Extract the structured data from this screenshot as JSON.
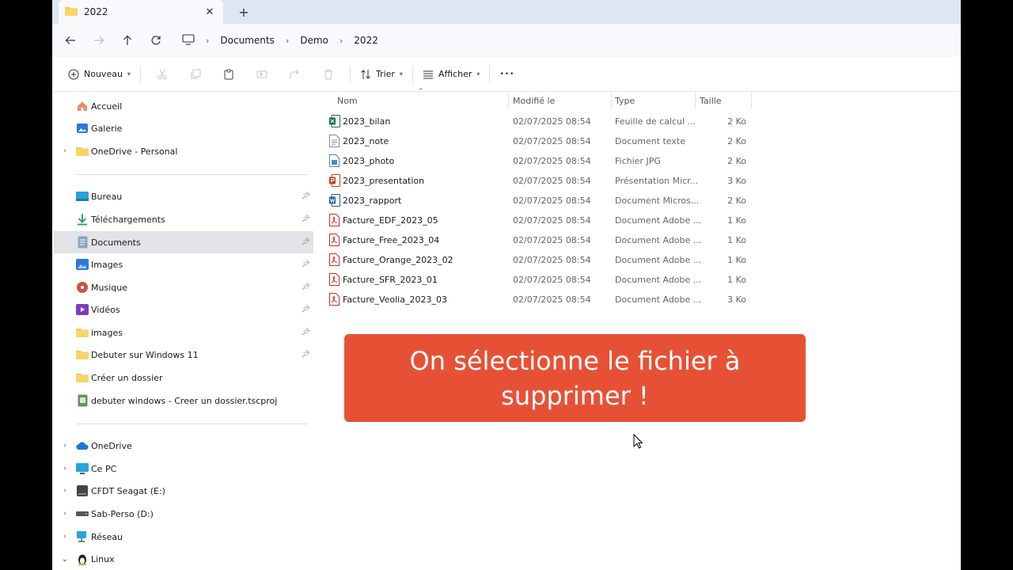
{
  "tab": {
    "title": "2022",
    "close": "✕",
    "new_tab": "+"
  },
  "address": {
    "crumbs": [
      "Documents",
      "Demo",
      "2022"
    ],
    "separator": "›"
  },
  "toolbar": {
    "new_label": "Nouveau",
    "sort_label": "Trier",
    "view_label": "Afficher",
    "more": "•••"
  },
  "sidebar": {
    "quick": [
      {
        "label": "Accueil",
        "icon": "home-icon"
      },
      {
        "label": "Galerie",
        "icon": "gallery-icon"
      },
      {
        "label": "OneDrive - Personal",
        "icon": "folder-icon",
        "expandable": true
      }
    ],
    "pinned": [
      {
        "label": "Bureau",
        "icon": "desktop-icon",
        "pinned": true
      },
      {
        "label": "Téléchargements",
        "icon": "download-icon",
        "pinned": true
      },
      {
        "label": "Documents",
        "icon": "documents-icon",
        "pinned": true,
        "selected": true
      },
      {
        "label": "Images",
        "icon": "images-icon",
        "pinned": true
      },
      {
        "label": "Musique",
        "icon": "music-icon",
        "pinned": true
      },
      {
        "label": "Vidéos",
        "icon": "video-icon",
        "pinned": true
      },
      {
        "label": "images",
        "icon": "folder-icon",
        "pinned": true
      },
      {
        "label": "Debuter sur Windows 11",
        "icon": "folder-icon",
        "pinned": true
      },
      {
        "label": "Créer un dossier",
        "icon": "folder-icon",
        "pinned": false
      },
      {
        "label": "debuter windows - Creer un dossier.tscproj",
        "icon": "project-icon",
        "pinned": false
      }
    ],
    "devices": [
      {
        "label": "OneDrive",
        "icon": "cloud-icon",
        "expanded": false
      },
      {
        "label": "Ce PC",
        "icon": "pc-icon",
        "expanded": false
      },
      {
        "label": "CFDT Seagat (E:)",
        "icon": "drive-icon",
        "expanded": false
      },
      {
        "label": "Sab-Perso (D:)",
        "icon": "drive-icon",
        "expanded": false
      },
      {
        "label": "Réseau",
        "icon": "network-icon",
        "expanded": false
      },
      {
        "label": "Linux",
        "icon": "linux-icon",
        "expanded": true
      }
    ]
  },
  "columns": {
    "name": "Nom",
    "modified": "Modifié le",
    "type": "Type",
    "size": "Taille"
  },
  "files": [
    {
      "name": "2023_bilan",
      "modified": "02/07/2025 08:54",
      "type": "Feuille de calcul ...",
      "size": "2 Ko",
      "icon": "excel-icon"
    },
    {
      "name": "2023_note",
      "modified": "02/07/2025 08:54",
      "type": "Document texte",
      "size": "2 Ko",
      "icon": "text-file-icon"
    },
    {
      "name": "2023_photo",
      "modified": "02/07/2025 08:54",
      "type": "Fichier JPG",
      "size": "2 Ko",
      "icon": "image-file-icon"
    },
    {
      "name": "2023_presentation",
      "modified": "02/07/2025 08:54",
      "type": "Présentation Micr...",
      "size": "3 Ko",
      "icon": "powerpoint-icon"
    },
    {
      "name": "2023_rapport",
      "modified": "02/07/2025 08:54",
      "type": "Document Micros...",
      "size": "2 Ko",
      "icon": "word-icon"
    },
    {
      "name": "Facture_EDF_2023_05",
      "modified": "02/07/2025 08:54",
      "type": "Document Adobe ...",
      "size": "1 Ko",
      "icon": "pdf-icon"
    },
    {
      "name": "Facture_Free_2023_04",
      "modified": "02/07/2025 08:54",
      "type": "Document Adobe ...",
      "size": "1 Ko",
      "icon": "pdf-icon"
    },
    {
      "name": "Facture_Orange_2023_02",
      "modified": "02/07/2025 08:54",
      "type": "Document Adobe ...",
      "size": "1 Ko",
      "icon": "pdf-icon"
    },
    {
      "name": "Facture_SFR_2023_01",
      "modified": "02/07/2025 08:54",
      "type": "Document Adobe ...",
      "size": "1 Ko",
      "icon": "pdf-icon"
    },
    {
      "name": "Facture_Veolia_2023_03",
      "modified": "02/07/2025 08:54",
      "type": "Document Adobe ...",
      "size": "3 Ko",
      "icon": "pdf-icon"
    }
  ],
  "banner": {
    "text": "On sélectionne le fichier à supprimer !"
  },
  "colors": {
    "banner": "#e65136",
    "selected": "#e1e3e8",
    "folder": "#f4c84e"
  }
}
